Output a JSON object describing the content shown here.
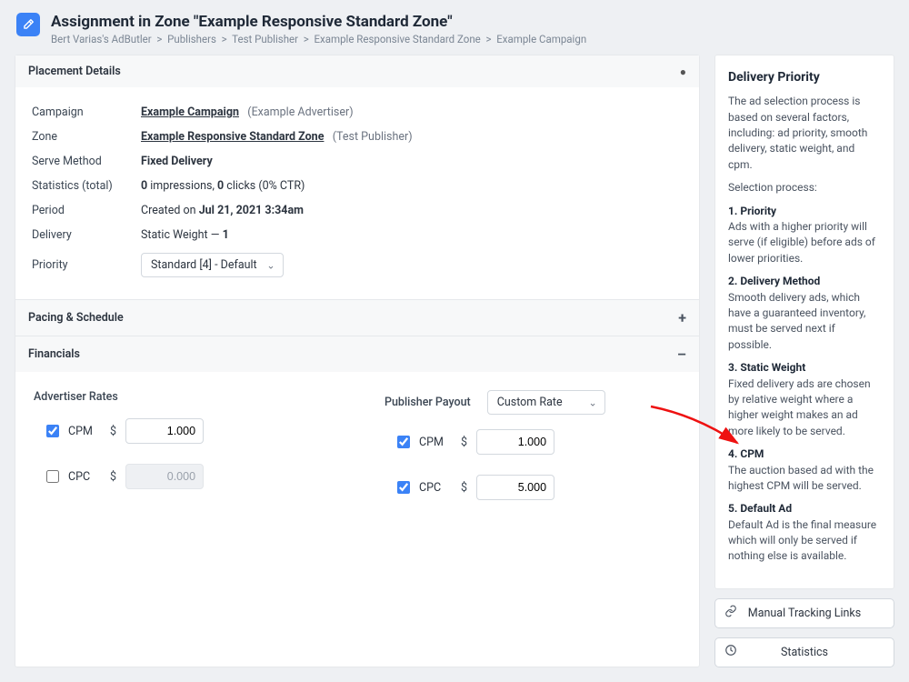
{
  "header": {
    "title": "Assignment in Zone \"Example Responsive Standard Zone\"",
    "breadcrumb": [
      "Bert Varias's AdButler",
      "Publishers",
      "Test Publisher",
      "Example Responsive Standard Zone",
      "Example Campaign"
    ]
  },
  "sections": {
    "placement": {
      "title": "Placement Details",
      "campaign_label": "Campaign",
      "campaign_value": "Example Campaign",
      "campaign_advertiser": "(Example Advertiser)",
      "zone_label": "Zone",
      "zone_value": "Example Responsive Standard Zone",
      "zone_publisher": "(Test Publisher)",
      "serve_method_label": "Serve Method",
      "serve_method_value": "Fixed Delivery",
      "stats_label": "Statistics (total)",
      "stats_impressions_count": "0",
      "stats_impressions_word": " impressions, ",
      "stats_clicks_count": "0",
      "stats_clicks_word": " clicks (0% CTR)",
      "period_label": "Period",
      "period_prefix": "Created on ",
      "period_value": "Jul 21, 2021 3:34am",
      "delivery_label": "Delivery",
      "delivery_value_text": "Static Weight — ",
      "delivery_weight": "1",
      "priority_label": "Priority",
      "priority_selected": "Standard [4] - Default"
    },
    "pacing": {
      "title": "Pacing & Schedule"
    },
    "financials": {
      "title": "Financials",
      "advertiser_rates_label": "Advertiser Rates",
      "publisher_payout_label": "Publisher Payout",
      "publisher_payout_selected": "Custom Rate",
      "cpm_label": "CPM",
      "cpc_label": "CPC",
      "currency": "$",
      "adv_cpm_value": "1.000",
      "adv_cpc_value": "0.000",
      "pub_cpm_value": "1.000",
      "pub_cpc_value": "5.000"
    }
  },
  "sidebar": {
    "title": "Delivery Priority",
    "intro": "The ad selection process is based on several factors, including: ad priority, smooth delivery, static weight, and cpm.",
    "selection_label": "Selection process:",
    "steps": [
      {
        "title": "1. Priority",
        "body": "Ads with a higher priority will serve (if eligible) before ads of lower priorities."
      },
      {
        "title": "2. Delivery Method",
        "body": "Smooth delivery ads, which have a guaranteed inventory, must be served next if possible."
      },
      {
        "title": "3. Static Weight",
        "body": "Fixed delivery ads are chosen by relative weight where a higher weight makes an ad more likely to be served."
      },
      {
        "title": "4. CPM",
        "body": "The auction based ad with the highest CPM will be served."
      },
      {
        "title": "5. Default Ad",
        "body": "Default Ad is the final measure which will only be served if nothing else is available."
      }
    ],
    "manual_tracking_label": "Manual Tracking Links",
    "statistics_label": "Statistics"
  }
}
